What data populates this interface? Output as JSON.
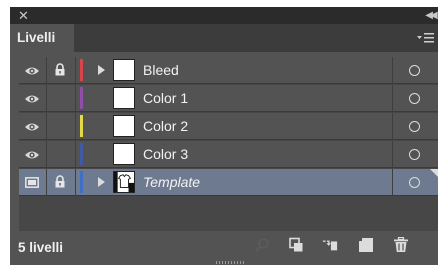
{
  "window": {
    "close_icon": "close-icon",
    "collapse_icon": "double-chevron-icon"
  },
  "panel": {
    "tab_label": "Livelli",
    "menu_icon": "panel-menu-icon"
  },
  "layers": [
    {
      "name": "Bleed",
      "visible": true,
      "locked": true,
      "expand": true,
      "color": "#d9434b",
      "thumb": "blank",
      "italic": false,
      "selected": false
    },
    {
      "name": "Color 1",
      "visible": true,
      "locked": false,
      "expand": false,
      "color": "#8f4fa8",
      "thumb": "blank",
      "italic": false,
      "selected": false
    },
    {
      "name": "Color 2",
      "visible": true,
      "locked": false,
      "expand": false,
      "color": "#e3d94a",
      "thumb": "blank",
      "italic": false,
      "selected": false
    },
    {
      "name": "Color 3",
      "visible": true,
      "locked": false,
      "expand": false,
      "color": "#3f5ba6",
      "thumb": "blank",
      "italic": false,
      "selected": false
    },
    {
      "name": "Template",
      "visible": false,
      "locked": true,
      "expand": true,
      "color": "#3f6fc4",
      "thumb": "shirt",
      "italic": true,
      "selected": true
    }
  ],
  "footer": {
    "count": "5 livelli",
    "icons": [
      "search-icon",
      "collect-for-export-icon",
      "make-clipping-mask-icon",
      "new-layer-icon",
      "trash-icon"
    ]
  },
  "colors": {
    "panel_bg": "#535353",
    "selected_row": "#6e7a8f",
    "header_bg": "#2b2b2b"
  }
}
